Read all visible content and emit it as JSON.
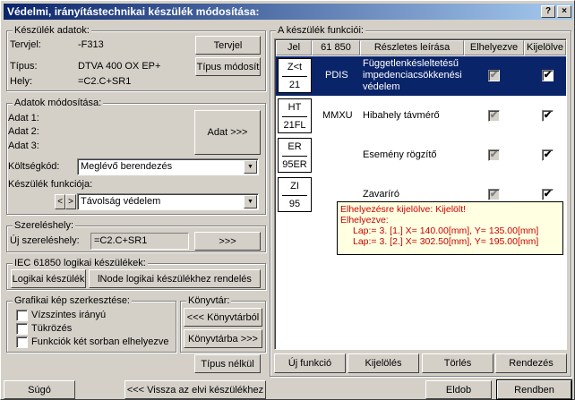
{
  "window": {
    "title": "Védelmi, irányítástechnikai készülék módosítása:",
    "close": "×",
    "help": "?"
  },
  "device": {
    "legend": "Készülék adatok:",
    "tervjel_label": "Tervjel:",
    "tervjel": "-F313",
    "tervjel_btn": "Tervjel",
    "tipus_label": "Típus:",
    "tipus": "DTVA 400 OX EP+",
    "tipus_btn": "Típus módosít",
    "hely_label": "Hely:",
    "hely": "=C2.C+SR1"
  },
  "modify": {
    "legend": "Adatok módosítása:",
    "adat1": "Adat 1:",
    "adat2": "Adat 2:",
    "adat3": "Adat 3:",
    "adat_btn": "Adat >>>",
    "cost_label": "Költségkód:",
    "cost_value": "Meglévő berendezés",
    "func_label": "Készülék funkciója:",
    "func_value": "Távolság védelem",
    "prev": "<",
    "next": ">"
  },
  "mount": {
    "legend": "Szereléshely:",
    "new_label": "Új szereléshely:",
    "value": "=C2.C+SR1",
    "btn": ">>>"
  },
  "iec": {
    "legend": "IEC 61850 logikai készülékek:",
    "btn1": "Logikai készülék",
    "btn2": "lNode logikai készülékhez rendelés"
  },
  "graphics": {
    "legend": "Grafikai kép szerkesztése:",
    "opt1": "Vízszintes irányú",
    "opt2": "Tükrözés",
    "opt3": "Funkciók két sorban elhelyezve"
  },
  "library": {
    "legend": "Könyvtár:",
    "from": "<<< Könyvtárból",
    "to": "Könyvtárba >>>"
  },
  "type_none": "Típus nélkül",
  "functions": {
    "legend": "A készülék funkciói:",
    "headers": [
      "Jel",
      "61 850",
      "Részletes leírása",
      "Elhelyezve",
      "Kijelölve"
    ],
    "rows": [
      {
        "sym_top": "Z<t",
        "sym_bottom": "21",
        "code": "PDIS",
        "desc": "Függetlenkésleltetésű impedenciacsökkenési védelem",
        "placed": true,
        "selected": true
      },
      {
        "sym_top": "HT",
        "sym_bottom": "21FL",
        "code": "MMXU",
        "desc": "Hibahely távmérő",
        "placed": true,
        "selected": true
      },
      {
        "sym_top": "ER",
        "sym_bottom": "95ER",
        "code": "",
        "desc": "Esemény rögzítő",
        "placed": true,
        "selected": true
      },
      {
        "sym_top": "ZI",
        "sym_bottom": "95",
        "code": "",
        "desc": "Zavaríró",
        "placed": true,
        "selected": true
      }
    ],
    "tooltip": [
      "Elhelyezésre kijelölve: Kijelölt!",
      "Elhelyezve:",
      "Lap:= 3. [1.]  X= 140.00[mm],  Y= 135.00[mm]",
      "Lap:= 3. [2.]  X= 302.50[mm],  Y= 195.00[mm]"
    ],
    "buttons": {
      "new": "Új funkció",
      "select": "Kijelölés",
      "delete": "Törlés",
      "sort": "Rendezés"
    }
  },
  "footer": {
    "help": "Súgó",
    "back": "<<< Vissza az elvi készülékhez",
    "discard": "Eldob",
    "ok": "Rendben"
  }
}
